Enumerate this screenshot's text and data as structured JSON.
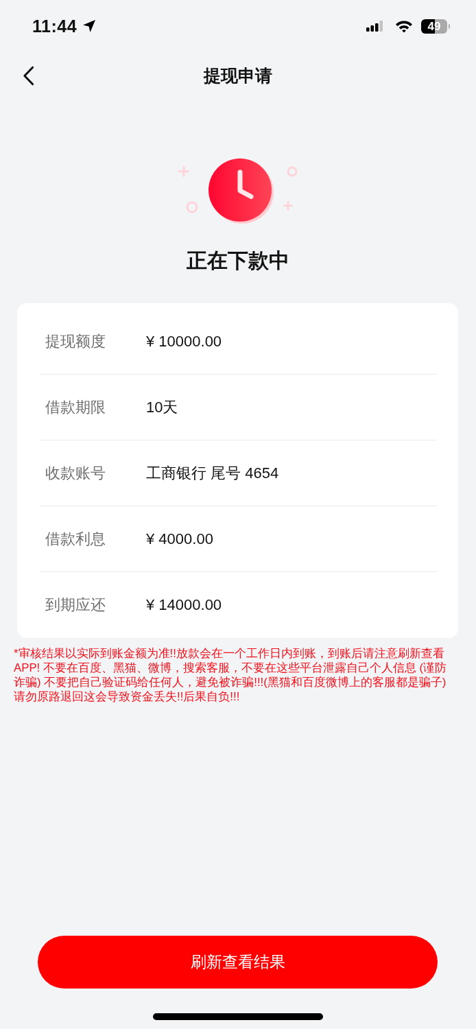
{
  "status_bar": {
    "time": "11:44",
    "battery": "49"
  },
  "nav": {
    "title": "提现申请"
  },
  "status": {
    "title": "正在下款中"
  },
  "details": [
    {
      "label": "提现额度",
      "value": "¥ 10000.00"
    },
    {
      "label": "借款期限",
      "value": "10天"
    },
    {
      "label": "收款账号",
      "value": "工商银行 尾号 4654"
    },
    {
      "label": "借款利息",
      "value": "¥ 4000.00"
    },
    {
      "label": "到期应还",
      "value": "¥ 14000.00"
    }
  ],
  "notice": "*审核结果以实际到账金额为准!!放款会在一个工作日内到账，到账后请注意刷新查看APP! 不要在百度、黑猫、微博，搜索客服，不要在这些平台泄露自己个人信息 (谨防诈骗) 不要把自己验证码给任何人，避免被诈骗!!!(黑猫和百度微博上的客服都是骗子)请勿原路退回这会导致资金丢失!!后果自负!!!",
  "action_button": {
    "label": "刷新查看结果"
  }
}
